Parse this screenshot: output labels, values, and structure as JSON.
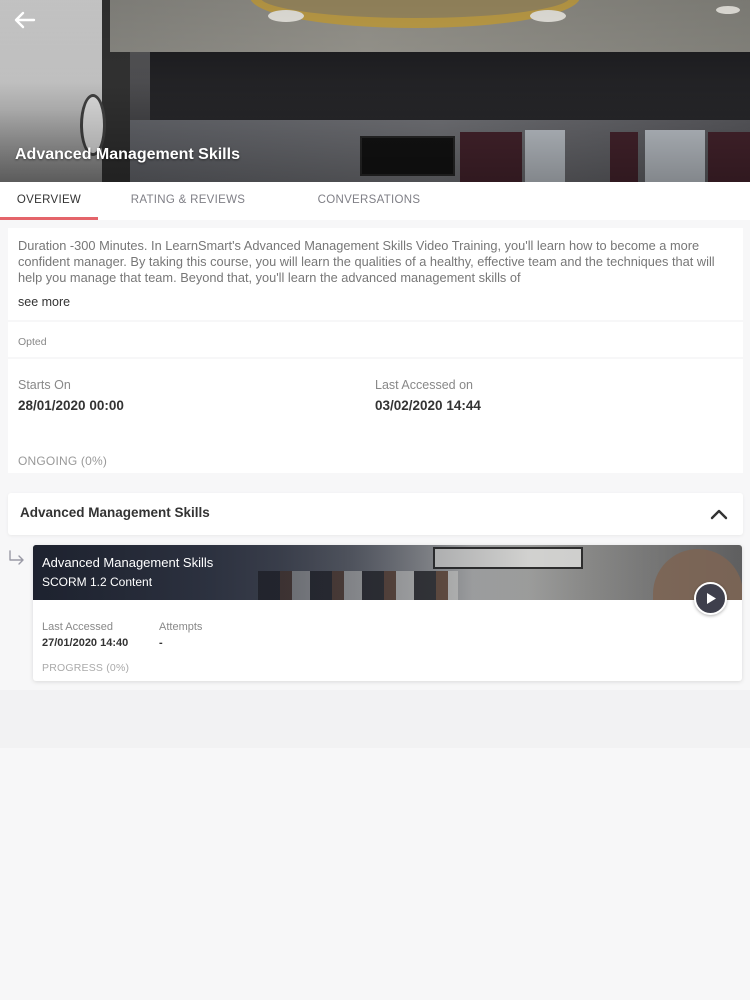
{
  "header": {
    "title": "Advanced Management Skills",
    "back_icon": "arrow-left-icon"
  },
  "tabs": [
    {
      "label": "OVERVIEW",
      "active": true
    },
    {
      "label": "RATING & REVIEWS",
      "active": false
    },
    {
      "label": "CONVERSATIONS",
      "active": false
    }
  ],
  "overview": {
    "description": "Duration -300 Minutes. In LearnSmart's Advanced Management Skills Video Training, you'll learn how to become a more confident manager. By taking this course, you will learn the qualities of a healthy, effective team and the techniques that will help you manage that team. Beyond that, you'll learn the advanced management skills of",
    "see_more": "see more",
    "status_label": "Opted",
    "starts_on_label": "Starts On",
    "starts_on_value": "28/01/2020 00:00",
    "last_accessed_label": "Last Accessed on",
    "last_accessed_value": "03/02/2020 14:44",
    "progress_status": "ONGOING (0%)"
  },
  "module": {
    "section_title": "Advanced Management Skills",
    "collapse_icon": "chevron-up-icon",
    "sub_icon": "sub-item-arrow-icon",
    "content": {
      "title": "Advanced Management Skills",
      "type": "SCORM 1.2 Content",
      "last_accessed_label": "Last Accessed",
      "last_accessed_value": "27/01/2020 14:40",
      "attempts_label": "Attempts",
      "attempts_value": "-",
      "progress": "PROGRESS (0%)",
      "play_icon": "play-icon"
    }
  },
  "colors": {
    "accent": "#e4646a",
    "play_button": "#3e3f4c"
  }
}
